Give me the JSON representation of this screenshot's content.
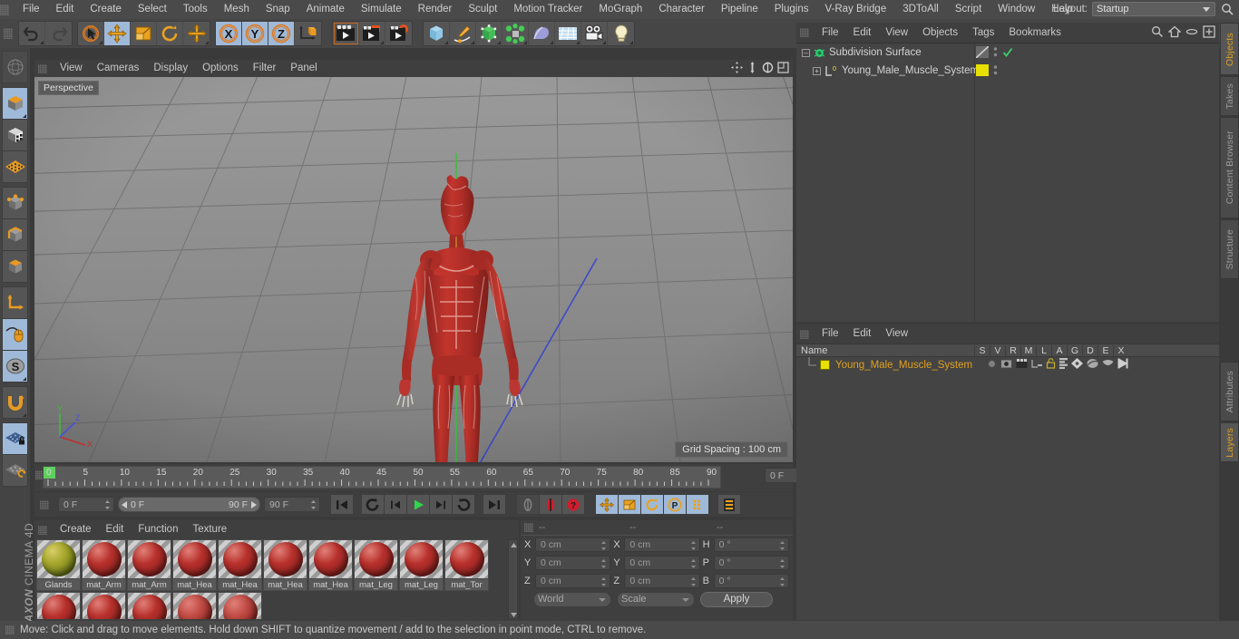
{
  "app": {
    "brand_line1": "MAXON",
    "brand_line2": "CINEMA 4D",
    "layout_label": "Layout:",
    "layout_value": "Startup"
  },
  "menubar": {
    "items": [
      {
        "label": "File"
      },
      {
        "label": "Edit"
      },
      {
        "label": "Create"
      },
      {
        "label": "Select"
      },
      {
        "label": "Tools"
      },
      {
        "label": "Mesh"
      },
      {
        "label": "Snap"
      },
      {
        "label": "Animate"
      },
      {
        "label": "Simulate"
      },
      {
        "label": "Render"
      },
      {
        "label": "Sculpt"
      },
      {
        "label": "Motion Tracker"
      },
      {
        "label": "MoGraph"
      },
      {
        "label": "Character"
      },
      {
        "label": "Pipeline"
      },
      {
        "label": "Plugins"
      },
      {
        "label": "V-Ray Bridge"
      },
      {
        "label": "3DToAll"
      },
      {
        "label": "Script"
      },
      {
        "label": "Window"
      },
      {
        "label": "Help"
      }
    ]
  },
  "toolbar": {
    "groups": [
      {
        "name": "history",
        "buttons": [
          {
            "icon": "undo-icon",
            "state": "normal"
          },
          {
            "icon": "redo-icon",
            "state": "disabled"
          }
        ]
      },
      {
        "name": "tools",
        "buttons": [
          {
            "icon": "live-selection-icon",
            "state": "normal"
          },
          {
            "icon": "move-tool-icon",
            "state": "active"
          },
          {
            "icon": "scale-tool-icon",
            "state": "normal"
          },
          {
            "icon": "rotate-tool-icon",
            "state": "normal"
          },
          {
            "icon": "move-alt-icon",
            "state": "normal"
          }
        ]
      },
      {
        "name": "axis-locks",
        "buttons": [
          {
            "icon": "axis-x-icon",
            "state": "active",
            "label": "X"
          },
          {
            "icon": "axis-y-icon",
            "state": "active",
            "label": "Y"
          },
          {
            "icon": "axis-z-icon",
            "state": "active",
            "label": "Z"
          },
          {
            "icon": "world-coordinates-icon",
            "state": "normal"
          }
        ]
      },
      {
        "name": "render",
        "buttons": [
          {
            "icon": "render-view-icon",
            "state": "selected"
          },
          {
            "icon": "render-region-icon",
            "state": "normal"
          },
          {
            "icon": "render-settings-icon",
            "state": "normal"
          }
        ]
      },
      {
        "name": "objects",
        "buttons": [
          {
            "icon": "cube-primitive-icon",
            "state": "normal"
          },
          {
            "icon": "spline-pen-icon",
            "state": "normal"
          },
          {
            "icon": "generator-icon",
            "state": "normal"
          },
          {
            "icon": "mograph-icon",
            "state": "normal"
          },
          {
            "icon": "deformer-icon",
            "state": "normal"
          },
          {
            "icon": "environment-icon",
            "state": "normal"
          },
          {
            "icon": "camera-icon",
            "state": "normal"
          },
          {
            "icon": "light-icon",
            "state": "normal"
          }
        ]
      }
    ]
  },
  "left_toolbar": {
    "buttons": [
      {
        "icon": "make-editable-icon",
        "state": "disabled"
      },
      {
        "icon": "model-mode-icon",
        "state": "active"
      },
      {
        "icon": "texture-mode-icon",
        "state": "normal"
      },
      {
        "icon": "polygon-mode-icon",
        "state": "normal"
      },
      {
        "icon": "points-mode-icon",
        "state": "normal"
      },
      {
        "icon": "edges-mode-icon",
        "state": "normal"
      },
      {
        "icon": "polygons-mode-icon",
        "state": "normal"
      },
      {
        "icon": "axis-modify-icon",
        "state": "normal"
      },
      {
        "icon": "enable-snapping-icon",
        "state": "active"
      },
      {
        "icon": "workplane-icon",
        "state": "active"
      },
      {
        "icon": "magnet-icon",
        "state": "normal"
      },
      {
        "icon": "lock-workplane-icon",
        "state": "active"
      },
      {
        "icon": "planar-workplane-icon",
        "state": "normal"
      }
    ]
  },
  "viewport": {
    "menu": [
      {
        "label": "View"
      },
      {
        "label": "Cameras"
      },
      {
        "label": "Display"
      },
      {
        "label": "Options"
      },
      {
        "label": "Filter"
      },
      {
        "label": "Panel"
      }
    ],
    "panel_icons": [
      "pan-view-icon",
      "zoom-view-icon",
      "rotate-view-icon",
      "maximize-view-icon"
    ],
    "camera_label": "Perspective",
    "grid_spacing": "Grid Spacing : 100 cm",
    "axis_gizmo": {
      "x": "X",
      "y": "Y",
      "z": "Z"
    },
    "scene_object": "Young_Male_Muscle_System"
  },
  "timeline": {
    "start_tick": 0,
    "end_tick": 90,
    "tick_labels": [
      "0",
      "5",
      "10",
      "15",
      "20",
      "25",
      "30",
      "35",
      "40",
      "45",
      "50",
      "55",
      "60",
      "65",
      "70",
      "75",
      "80",
      "85",
      "90"
    ],
    "current_frame_field": "0 F",
    "playhead_frame": "0 F"
  },
  "transport": {
    "current_frame": "0 F",
    "range_start": "0 F",
    "range_end": "90 F",
    "end_frame": "90 F",
    "buttons": [
      {
        "icon": "go-to-start-icon",
        "state": "normal"
      },
      {
        "icon": "play-reverse-loop-icon",
        "state": "normal"
      },
      {
        "icon": "previous-frame-icon",
        "state": "normal"
      },
      {
        "icon": "play-forward-icon",
        "state": "normal"
      },
      {
        "icon": "next-frame-icon",
        "state": "normal"
      },
      {
        "icon": "play-loop-icon",
        "state": "normal"
      },
      {
        "icon": "go-to-end-icon",
        "state": "normal"
      },
      {
        "icon": "record-active-objects-icon",
        "state": "disabled"
      },
      {
        "icon": "autokeying-icon",
        "state": "normal"
      },
      {
        "icon": "keyframe-selection-icon",
        "state": "normal"
      },
      {
        "icon": "key-position-icon",
        "state": "active"
      },
      {
        "icon": "key-scale-icon",
        "state": "active"
      },
      {
        "icon": "key-rotation-icon",
        "state": "active"
      },
      {
        "icon": "key-parameter-icon",
        "state": "active"
      },
      {
        "icon": "key-pla-icon",
        "state": "active"
      },
      {
        "icon": "timeline-toggle-icon",
        "state": "normal"
      }
    ]
  },
  "material_manager": {
    "menu": [
      {
        "label": "Create"
      },
      {
        "label": "Edit"
      },
      {
        "label": "Function"
      },
      {
        "label": "Texture"
      }
    ],
    "materials": [
      {
        "name": "Glands",
        "color": "#9aa02a",
        "kind": "olive"
      },
      {
        "name": "mat_Arm",
        "color": "#b8302c",
        "kind": "muscle"
      },
      {
        "name": "mat_Arm",
        "color": "#b8302c",
        "kind": "muscle"
      },
      {
        "name": "mat_Hea",
        "color": "#b8302c",
        "kind": "muscle"
      },
      {
        "name": "mat_Hea",
        "color": "#b8302c",
        "kind": "muscle"
      },
      {
        "name": "mat_Hea",
        "color": "#b8302c",
        "kind": "muscle"
      },
      {
        "name": "mat_Hea",
        "color": "#b8302c",
        "kind": "muscle"
      },
      {
        "name": "mat_Leg",
        "color": "#b8302c",
        "kind": "muscle"
      },
      {
        "name": "mat_Leg",
        "color": "#b8302c",
        "kind": "muscle"
      },
      {
        "name": "mat_Tor",
        "color": "#b8302c",
        "kind": "muscle"
      },
      {
        "name": "",
        "color": "#b8302c",
        "kind": "muscle"
      },
      {
        "name": "",
        "color": "#b8302c",
        "kind": "muscle"
      },
      {
        "name": "",
        "color": "#b8302c",
        "kind": "muscle"
      },
      {
        "name": "",
        "color": "#c04a44",
        "kind": "muscle"
      },
      {
        "name": "",
        "color": "#c04a44",
        "kind": "muscle"
      }
    ]
  },
  "coordinates": {
    "header": [
      "--",
      "--",
      "--"
    ],
    "position": {
      "label_x": "X",
      "label_y": "Y",
      "label_z": "Z",
      "x": "0 cm",
      "y": "0 cm",
      "z": "0 cm"
    },
    "size": {
      "label_x": "X",
      "label_y": "Y",
      "label_z": "Z",
      "x": "0 cm",
      "y": "0 cm",
      "z": "0 cm"
    },
    "rotation": {
      "label_h": "H",
      "label_p": "P",
      "label_b": "B",
      "h": "0 °",
      "p": "0 °",
      "b": "0 °"
    },
    "system": "World",
    "mode": "Scale",
    "apply_label": "Apply"
  },
  "object_manager": {
    "menu": [
      {
        "label": "File"
      },
      {
        "label": "Edit"
      },
      {
        "label": "View"
      },
      {
        "label": "Objects"
      },
      {
        "label": "Tags"
      },
      {
        "label": "Bookmarks"
      }
    ],
    "header_icons": [
      "search-icon",
      "home-icon",
      "ellipse-icon",
      "fit-icon"
    ],
    "rows": [
      {
        "label": "Subdivision Surface",
        "icon": "subdivision-surface-icon",
        "indent": 0,
        "tag_swatch": "diagonal",
        "visible_check": "✓",
        "name_color": "#d2d2d2"
      },
      {
        "label": "Young_Male_Muscle_System",
        "icon": "object-layer-icon",
        "indent": 1,
        "tag_swatch": "#e8e000",
        "visible_check": "",
        "name_color": "#d2d2d2"
      }
    ]
  },
  "layer_manager": {
    "menu": [
      {
        "label": "File"
      },
      {
        "label": "Edit"
      },
      {
        "label": "View"
      }
    ],
    "columns": [
      "Name",
      "S",
      "V",
      "R",
      "M",
      "L",
      "A",
      "G",
      "D",
      "E",
      "X"
    ],
    "rows": [
      {
        "name": "Young_Male_Muscle_System",
        "color": "#e8e000",
        "text_color": "#e0a020"
      }
    ]
  },
  "tabs_right": [
    {
      "label": "Objects",
      "active": true
    },
    {
      "label": "Takes",
      "active": false
    },
    {
      "label": "Content Browser",
      "active": false
    },
    {
      "label": "Structure",
      "active": false
    },
    {
      "label": "Attributes",
      "active": false
    },
    {
      "label": "Layers",
      "active": true
    }
  ],
  "statusbar": {
    "message": "Move: Click and drag to move elements. Hold down SHIFT to quantize movement / add to the selection in point mode, CTRL to remove."
  },
  "colors": {
    "accent_orange": "#e0901f",
    "panel_bg": "#3f3f3f",
    "toolbar_bg": "#464646",
    "active_blue": "#9fb9d8",
    "viewport_bg": "#8a8a8a",
    "model_red": "#b8302c",
    "axis_x": "#c0392b",
    "axis_y": "#2ecc40",
    "axis_z": "#3344cc"
  }
}
